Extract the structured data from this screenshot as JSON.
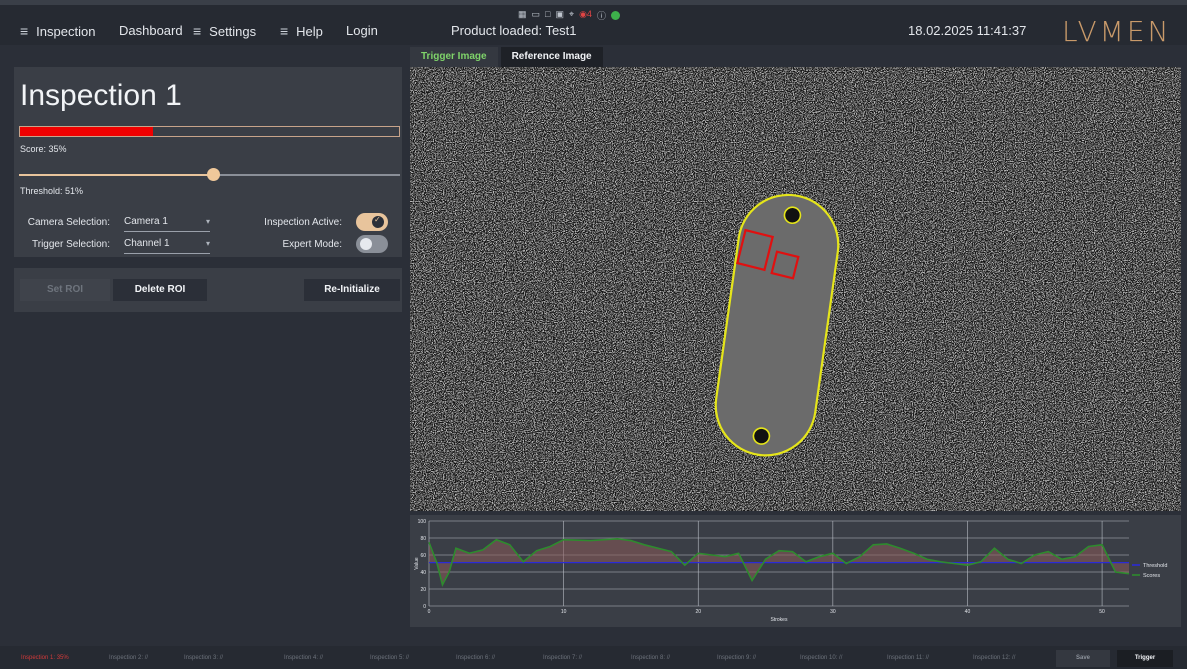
{
  "menu": {
    "inspection": "Inspection",
    "dashboard": "Dashboard",
    "settings": "Settings",
    "help": "Help",
    "login": "Login"
  },
  "header": {
    "product": "Product loaded: Test1",
    "datetime": "18.02.2025 11:41:37",
    "logo": "LVMEN"
  },
  "tray": {
    "badge": "4"
  },
  "inspection": {
    "title": "Inspection 1",
    "score_value": 0.35,
    "score_label": "Score: 35%",
    "threshold_value": 0.51,
    "threshold_label": "Threshold: 51%",
    "camera_label": "Camera Selection:",
    "camera_value": "Camera 1",
    "trigger_label": "Trigger Selection:",
    "trigger_value": "Channel 1",
    "active_label": "Inspection Active:",
    "active_on": true,
    "expert_label": "Expert Mode:",
    "expert_on": false
  },
  "buttons": {
    "set_roi": "Set ROI",
    "delete_roi": "Delete ROI",
    "reinit": "Re-Initialize"
  },
  "tabs": {
    "trigger": "Trigger Image",
    "reference": "Reference Image"
  },
  "chart_data": {
    "type": "line",
    "xlabel": "Strokes",
    "ylabel": "Value",
    "xlim": [
      0,
      52
    ],
    "ylim": [
      0,
      100
    ],
    "xticks": [
      0,
      10,
      20,
      30,
      40,
      50
    ],
    "yticks": [
      0,
      20,
      40,
      60,
      80,
      100
    ],
    "series": [
      {
        "name": "Threshold",
        "color": "#2b2bd6",
        "x": [
          0,
          52
        ],
        "y": [
          51,
          51
        ]
      },
      {
        "name": "Scores",
        "color": "#2e8b2e",
        "x": [
          0,
          0.6,
          1,
          1.5,
          2,
          3,
          4,
          5,
          6,
          7,
          8,
          9,
          10,
          12,
          14,
          15,
          16,
          18,
          19,
          20,
          21,
          22,
          23,
          24,
          25,
          26,
          27,
          28,
          29,
          30,
          31,
          32,
          33,
          34,
          35,
          36,
          37,
          38,
          39,
          40,
          41,
          42,
          43,
          44,
          45,
          46,
          47,
          48,
          49,
          50,
          51,
          52
        ],
        "y": [
          75,
          50,
          25,
          40,
          68,
          62,
          66,
          78,
          72,
          52,
          65,
          70,
          78,
          77,
          79,
          77,
          72,
          64,
          48,
          62,
          60,
          58,
          62,
          30,
          55,
          65,
          64,
          52,
          58,
          62,
          50,
          58,
          72,
          73,
          68,
          62,
          55,
          52,
          50,
          48,
          52,
          68,
          55,
          50,
          60,
          64,
          55,
          58,
          70,
          72,
          40,
          38
        ]
      }
    ],
    "legend": "right"
  },
  "status": {
    "items": [
      "Inspection 1: 35%",
      "Inspection 2: //",
      "Inspection 3: //",
      "Inspection 4: //",
      "Inspection 5: //",
      "Inspection 6: //",
      "Inspection 7: //",
      "Inspection 8: //",
      "Inspection 9: //",
      "Inspection 10: //",
      "Inspection 11: //",
      "Inspection 12: //"
    ],
    "save": "Save",
    "trigger": "Trigger"
  }
}
